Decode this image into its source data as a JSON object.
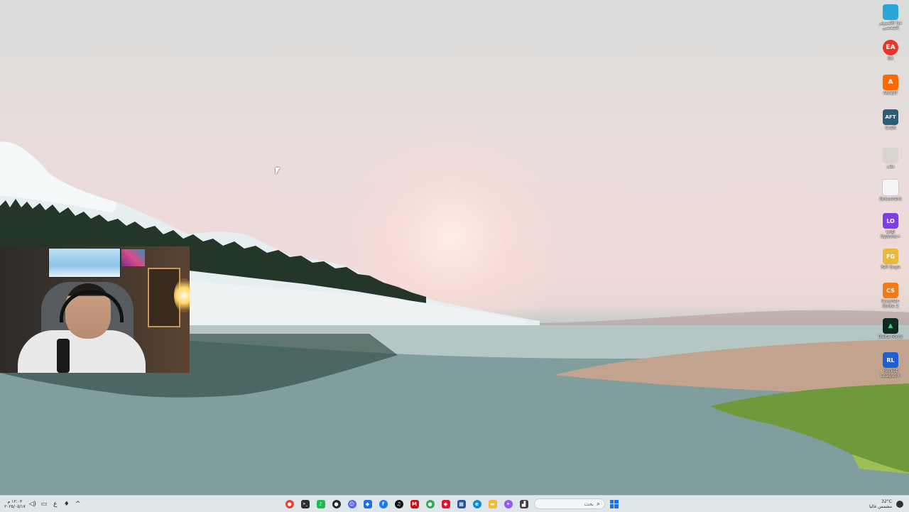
{
  "desktop_icons": [
    {
      "name": "this-pc",
      "label": "هذا الكمبيوتر الشخصي",
      "color": "#2aa7d8",
      "glyph": ""
    },
    {
      "name": "ea",
      "label": "EA",
      "color": "#e8362b",
      "glyph": "EA"
    },
    {
      "name": "faceit",
      "label": "FACEIT",
      "color": "#ff6a00",
      "glyph": "A"
    },
    {
      "name": "craft",
      "label": "Craft",
      "color": "#2b5c78",
      "glyph": "AFT"
    },
    {
      "name": "file-1",
      "label": "ملف",
      "color": "#d8d4cc",
      "glyph": ""
    },
    {
      "name": "file-2",
      "label": "Document",
      "color": "#f4f4f4",
      "glyph": ""
    },
    {
      "name": "logi-options",
      "label": "Logi Options+",
      "color": "#7b3fe4",
      "glyph": "LO"
    },
    {
      "name": "fall-guys",
      "label": "Fall Guys",
      "color": "#e8b93a",
      "glyph": "FG"
    },
    {
      "name": "counter-strike",
      "label": "Counter-Strike 2",
      "color": "#f07b1a",
      "glyph": "CS"
    },
    {
      "name": "delta-force",
      "label": "Delta Force",
      "color": "#0d2b1e",
      "glyph": "▲"
    },
    {
      "name": "rocket-league",
      "label": "Rocket League®",
      "color": "#1f5fd1",
      "glyph": "RL"
    }
  ],
  "taskbar": {
    "left": {
      "clock_time": "١٢:٠٣ م",
      "clock_date": "٢٠٢٥/٠٥/١٧",
      "lang": "ع",
      "chevron": "^"
    },
    "apps": [
      {
        "name": "chrome",
        "color": "#ea4335",
        "glyph": "●"
      },
      {
        "name": "terminal",
        "color": "#2d2d2d",
        "glyph": ">_"
      },
      {
        "name": "spotify-like",
        "color": "#1db954",
        "glyph": "♪"
      },
      {
        "name": "github",
        "color": "#24292e",
        "glyph": "●"
      },
      {
        "name": "discord",
        "color": "#5865f2",
        "glyph": "☺"
      },
      {
        "name": "shield",
        "color": "#1e6fd9",
        "glyph": "◆"
      },
      {
        "name": "facebook",
        "color": "#1877f2",
        "glyph": "f"
      },
      {
        "name": "tiktok",
        "color": "#111111",
        "glyph": "♫"
      },
      {
        "name": "mcafee",
        "color": "#c01818",
        "glyph": "M"
      },
      {
        "name": "maps",
        "color": "#34a853",
        "glyph": "●"
      },
      {
        "name": "ruby",
        "color": "#e0142a",
        "glyph": "◆"
      },
      {
        "name": "calculator",
        "color": "#2b579a",
        "glyph": "▦"
      },
      {
        "name": "edge",
        "color": "#0c8ddc",
        "glyph": "e"
      },
      {
        "name": "file-explorer",
        "color": "#f3b931",
        "glyph": "▬"
      },
      {
        "name": "copilot",
        "color": "#8e5cf0",
        "glyph": "✦"
      },
      {
        "name": "store",
        "color": "#3d3d3d",
        "glyph": "▟"
      }
    ],
    "search_placeholder": "بحث",
    "weather_temp": "32°C",
    "weather_text": "مشمس غالبا"
  }
}
